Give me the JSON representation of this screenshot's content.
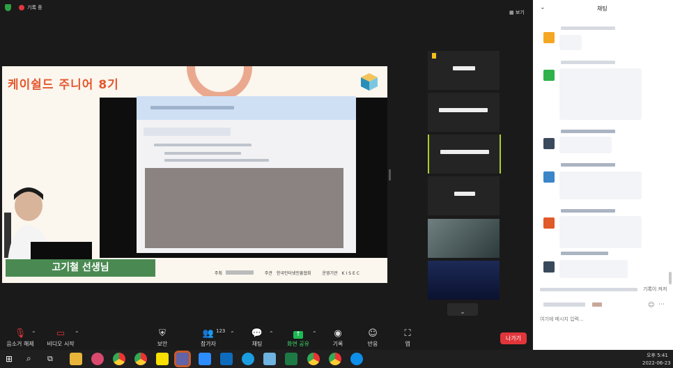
{
  "topbar": {
    "recording_label": "기록 중",
    "view_label": "보기"
  },
  "share": {
    "title": "케이쉴드 주니어 8기",
    "presenter_name": "고기철 선생님",
    "footer": {
      "host_label": "주최",
      "organizer_label": "주관",
      "organizer_name": "한국인터넷진흥협회",
      "operator_label": "운영기관",
      "operator_name": "KISEC"
    }
  },
  "chat": {
    "title": "채팅",
    "notice_text": "기록이 켜저",
    "input_placeholder": "여기에 메시지 입력..."
  },
  "toolbar": {
    "unmute_label": "음소거 해제",
    "start_video_label": "비디오 시작",
    "security_label": "보안",
    "participants_label": "참가자",
    "participants_count": "123",
    "chat_label": "채팅",
    "share_label": "화면 공유",
    "record_label": "기록",
    "reactions_label": "반응",
    "apps_label": "앱",
    "leave_label": "나가기"
  },
  "taskbar": {
    "time": "오후 5:41",
    "date": "2022-06-23"
  },
  "colors": {
    "accent_orange": "#e4572e",
    "name_green": "#4a8a52",
    "leave_red": "#e0363b",
    "share_green": "#1db954"
  }
}
